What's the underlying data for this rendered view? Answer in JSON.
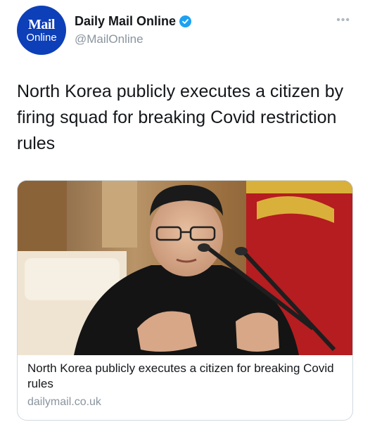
{
  "account": {
    "avatar_line1": "Mail",
    "avatar_line2": "Online",
    "display_name": "Daily Mail Online",
    "handle": "@MailOnline"
  },
  "tweet": {
    "text": "North Korea publicly executes a citizen by firing squad for breaking Covid restriction rules"
  },
  "card": {
    "title": "North Korea publicly executes a citizen for breaking Covid rules",
    "domain": "dailymail.co.uk"
  },
  "colors": {
    "avatar_bg": "#0d3fb8",
    "verified": "#1da1f2",
    "flag_red": "#b51d20",
    "flag_gold": "#d9b13a"
  },
  "icons": {
    "more": "more-horizontal-icon",
    "verified": "verified-badge-icon"
  }
}
